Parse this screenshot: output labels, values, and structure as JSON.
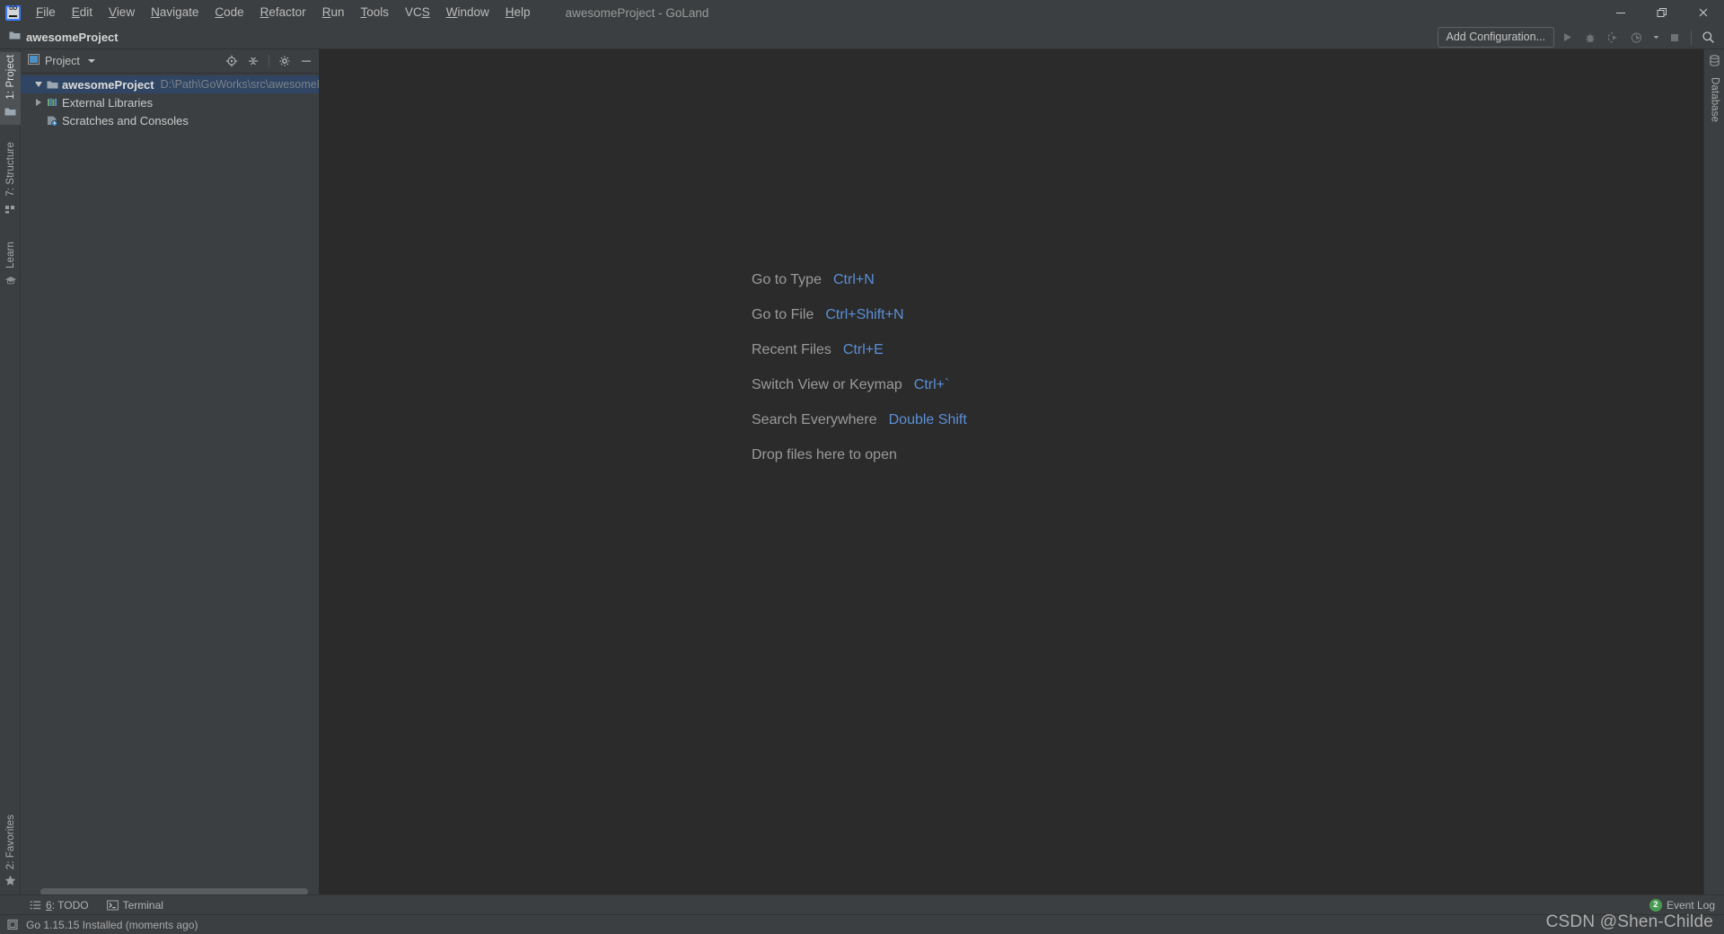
{
  "window": {
    "title": "awesomeProject - GoLand",
    "logo_icon": "goland-logo-icon",
    "minimize_icon": "minimize-icon",
    "restore_icon": "restore-icon",
    "close_icon": "close-icon"
  },
  "menu": [
    {
      "label": "File",
      "mnemonic": "F",
      "rest": "ile"
    },
    {
      "label": "Edit",
      "mnemonic": "E",
      "rest": "dit"
    },
    {
      "label": "View",
      "mnemonic": "V",
      "rest": "iew"
    },
    {
      "label": "Navigate",
      "mnemonic": "N",
      "rest": "avigate"
    },
    {
      "label": "Code",
      "mnemonic": "C",
      "rest": "ode"
    },
    {
      "label": "Refactor",
      "mnemonic": "R",
      "rest": "efactor"
    },
    {
      "label": "Run",
      "mnemonic": "R",
      "rest": "un"
    },
    {
      "label": "Tools",
      "mnemonic": "T",
      "rest": "ools"
    },
    {
      "label": "VCS",
      "mnemonic": "S",
      "rest": "",
      "prefix": "VC"
    },
    {
      "label": "Window",
      "mnemonic": "W",
      "rest": "indow"
    },
    {
      "label": "Help",
      "mnemonic": "H",
      "rest": "elp"
    }
  ],
  "navbar": {
    "breadcrumb": "awesomeProject",
    "folder_icon": "folder-icon"
  },
  "toolbar": {
    "add_configuration": "Add Configuration...",
    "run_icon": "run-icon",
    "debug_icon": "debug-icon",
    "coverage_icon": "run-with-coverage-icon",
    "profiler_icon": "profiler-icon",
    "profiler_dropdown_icon": "chevron-down-icon",
    "stop_icon": "stop-icon",
    "search_icon": "search-icon"
  },
  "left_tabs": [
    {
      "label": "1: Project",
      "icon": "project-folder-icon",
      "active": true
    },
    {
      "label": "7: Structure",
      "icon": "structure-icon",
      "active": false
    },
    {
      "label": "Learn",
      "icon": "learn-graduation-icon",
      "active": false
    }
  ],
  "left_tabs_bottom": [
    {
      "label": "2: Favorites",
      "icon": "star-icon",
      "active": false
    }
  ],
  "right_tabs": [
    {
      "label": "Database",
      "icon": "database-icon",
      "active": false
    }
  ],
  "project_panel": {
    "title": "Project",
    "dropdown_icon": "chevron-down-icon",
    "window_icon": "tool-window-icon",
    "tools": [
      {
        "name": "select-opened-file-icon",
        "label": "Select Opened File"
      },
      {
        "name": "collapse-all-icon",
        "label": "Collapse All"
      },
      {
        "name": "gear-icon",
        "label": "Options"
      },
      {
        "name": "hide-icon",
        "label": "Hide"
      }
    ],
    "tree": [
      {
        "label": "awesomeProject",
        "path": "D:\\Path\\GoWorks\\src\\awesomeP",
        "icon": "folder-icon",
        "expanded": true,
        "has_arrow": true,
        "selected": true,
        "bold": true,
        "indent": 0
      },
      {
        "label": "External Libraries",
        "path": "",
        "icon": "external-libraries-icon",
        "expanded": false,
        "has_arrow": true,
        "selected": false,
        "bold": false,
        "indent": 0
      },
      {
        "label": "Scratches and Consoles",
        "path": "",
        "icon": "scratches-icon",
        "expanded": false,
        "has_arrow": false,
        "selected": false,
        "bold": false,
        "indent": 0
      }
    ]
  },
  "editor_hints": [
    {
      "label": "Go to Type",
      "key": "Ctrl+N"
    },
    {
      "label": "Go to File",
      "key": "Ctrl+Shift+N"
    },
    {
      "label": "Recent Files",
      "key": "Ctrl+E"
    },
    {
      "label": "Switch View or Keymap",
      "key": "Ctrl+`"
    },
    {
      "label": "Search Everywhere",
      "key": "Double Shift"
    },
    {
      "label": "Drop files here to open",
      "key": ""
    }
  ],
  "bottom_tabs": [
    {
      "label": "6: TODO",
      "mnemonic": "6",
      "rest": ": TODO",
      "icon": "todo-list-icon"
    },
    {
      "label": "Terminal",
      "mnemonic": "",
      "rest": "Terminal",
      "icon": "terminal-icon"
    }
  ],
  "event_log": {
    "count": "2",
    "label": "Event Log"
  },
  "statusbar": {
    "icon": "memory-indicator-icon",
    "message": "Go 1.15.15 Installed (moments ago)"
  },
  "watermark": "CSDN @Shen-Childe",
  "colors": {
    "bg_chrome": "#3c3f41",
    "bg_editor": "#2b2b2b",
    "accent_blue": "#5b8fd6",
    "selection": "#2f4563",
    "badge_green": "#499c54",
    "text_primary": "#c9c9c9",
    "text_muted": "#9a9a9a"
  }
}
